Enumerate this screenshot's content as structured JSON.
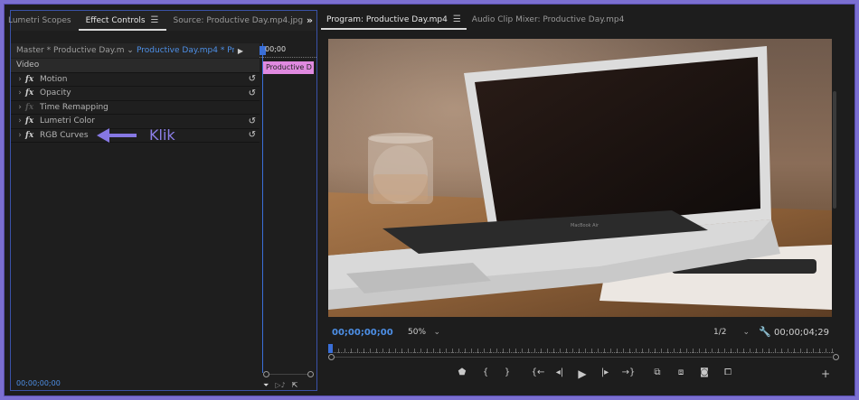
{
  "effect_controls_panel": {
    "tabs": [
      {
        "label": "Lumetri Scopes"
      },
      {
        "label": "Effect Controls"
      },
      {
        "label": "Source: Productive Day.mp4.jpg"
      }
    ],
    "expand_icon": "double-chevron-right-icon",
    "master_clip": "Master * Productive Day.mp4...",
    "sequence_clip": "Productive Day.mp4 * Pro...",
    "section_label": "Video",
    "effects": [
      {
        "name": "Motion",
        "enabled": true,
        "resettable": true
      },
      {
        "name": "Opacity",
        "enabled": true,
        "resettable": true
      },
      {
        "name": "Time Remapping",
        "enabled": false,
        "resettable": false
      },
      {
        "name": "Lumetri Color",
        "enabled": true,
        "resettable": true
      },
      {
        "name": "RGB Curves",
        "enabled": true,
        "resettable": true
      }
    ],
    "annotation": {
      "text": "Klik",
      "color": "#8678e3"
    },
    "current_time": "00;00;00;00",
    "mini_timeline": {
      "time": "00;00",
      "clip_label": "Productive D",
      "clip_color": "#e08ae0"
    }
  },
  "program_panel": {
    "tabs": [
      {
        "label": "Program: Productive Day.mp4"
      },
      {
        "label": "Audio Clip Mixer: Productive Day.mp4"
      }
    ],
    "current_time": "00;00;00;00",
    "zoom": "50%",
    "resolution": "1/2",
    "duration": "00;00;04;29",
    "transport_icons": [
      "marker-icon",
      "in-point-icon",
      "out-point-icon",
      "go-to-in-icon",
      "step-back-icon",
      "play-icon",
      "step-forward-icon",
      "go-to-out-icon",
      "insert-icon",
      "overwrite-icon",
      "camera-icon",
      "comparison-icon",
      "add-button-icon"
    ],
    "screen_text": "MacBook Air"
  },
  "colors": {
    "accent_blue": "#4d8fe6",
    "playhead": "#3a6fd8",
    "frame": "#7b6fd1"
  }
}
